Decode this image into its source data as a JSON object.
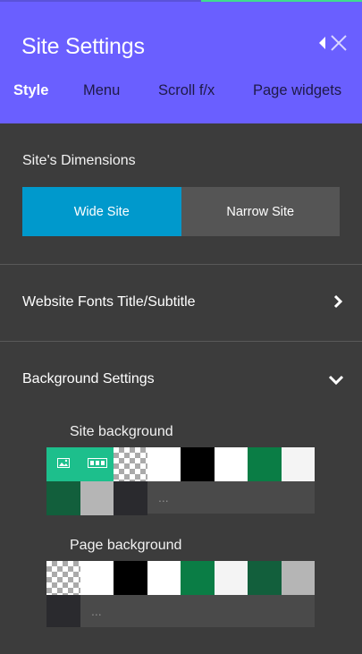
{
  "header": {
    "title": "Site Settings",
    "accent_color": "#6a5fff",
    "icons": [
      "back-icon",
      "close-icon"
    ]
  },
  "tabs": [
    {
      "label": "Style",
      "active": true
    },
    {
      "label": "Menu",
      "active": false
    },
    {
      "label": "Scroll f/x",
      "active": false
    },
    {
      "label": "Page widgets",
      "active": false
    }
  ],
  "dimensions": {
    "label": "Site's Dimensions",
    "options": [
      {
        "label": "Wide Site",
        "selected": true,
        "color": "#0099cc"
      },
      {
        "label": "Narrow Site",
        "selected": false,
        "color": "#555555"
      }
    ]
  },
  "sections": {
    "fonts": {
      "label": "Website Fonts Title/Subtitle",
      "icon": "chevron-right-icon"
    },
    "background": {
      "label": "Background Settings",
      "icon": "chevron-down-icon"
    }
  },
  "site_background": {
    "label": "Site background",
    "swatches": [
      {
        "kind": "image",
        "icon": "image-icon"
      },
      {
        "kind": "video",
        "icon": "video-icon"
      },
      {
        "kind": "transparent"
      },
      {
        "kind": "color",
        "color": "#ffffff"
      },
      {
        "kind": "color",
        "color": "#000000"
      },
      {
        "kind": "color",
        "color": "#ffffff"
      },
      {
        "kind": "color",
        "color": "#0a7d45"
      },
      {
        "kind": "color",
        "color": "#f4f4f4"
      },
      {
        "kind": "color",
        "color": "#125f3c"
      },
      {
        "kind": "color",
        "color": "#b5b5b5"
      },
      {
        "kind": "color",
        "color": "#2a2a2e"
      }
    ],
    "more_label": "..."
  },
  "page_background": {
    "label": "Page background",
    "swatches": [
      {
        "kind": "transparent"
      },
      {
        "kind": "color",
        "color": "#ffffff"
      },
      {
        "kind": "color",
        "color": "#000000"
      },
      {
        "kind": "color",
        "color": "#ffffff"
      },
      {
        "kind": "color",
        "color": "#0a7d45"
      },
      {
        "kind": "color",
        "color": "#f4f4f4"
      },
      {
        "kind": "color",
        "color": "#125f3c"
      },
      {
        "kind": "color",
        "color": "#b5b5b5"
      },
      {
        "kind": "color",
        "color": "#2a2a2e"
      }
    ],
    "more_label": "..."
  }
}
